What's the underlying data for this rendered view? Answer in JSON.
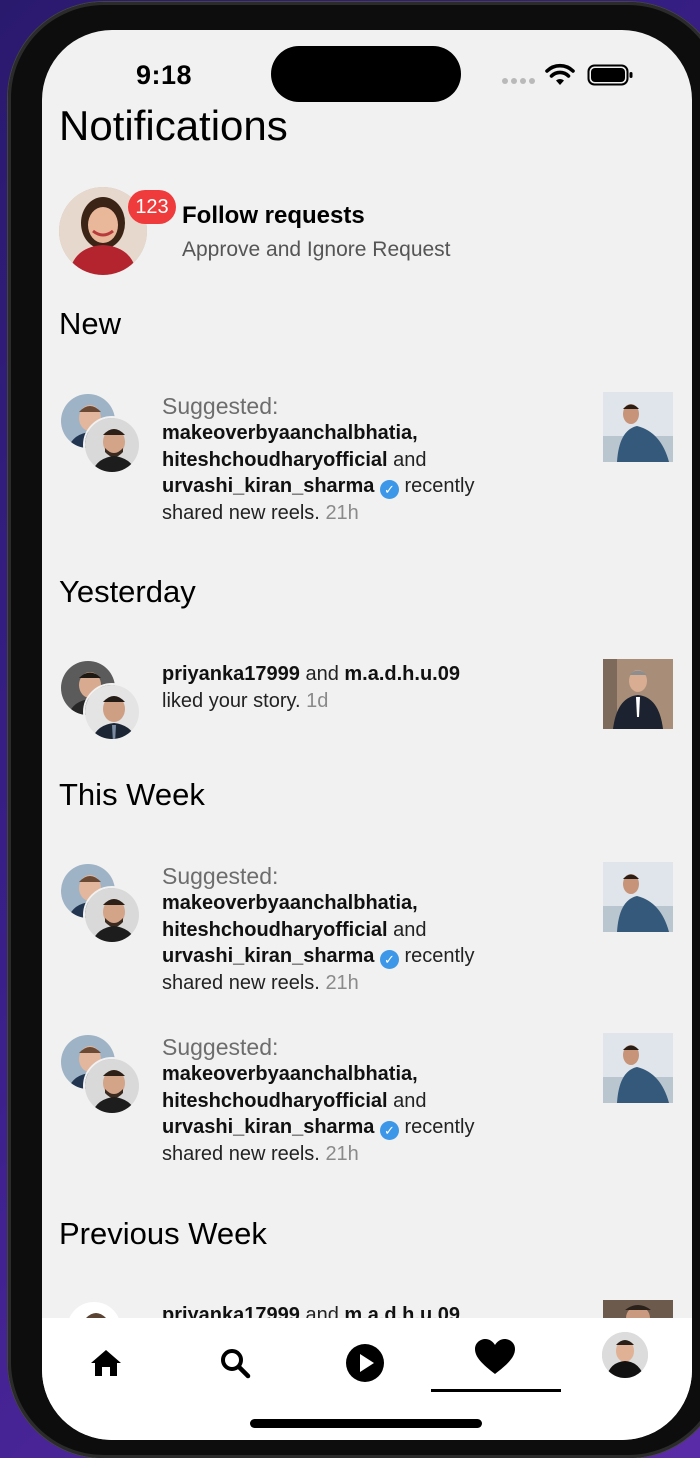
{
  "status_bar": {
    "time": "9:18"
  },
  "page": {
    "title": "Notifications"
  },
  "follow_requests": {
    "badge_count": "123",
    "title": "Follow requests",
    "subtitle": "Approve and Ignore Request"
  },
  "sections": {
    "new": "New",
    "yesterday": "Yesterday",
    "this_week": "This Week",
    "previous_week": "Previous Week"
  },
  "suggested_reel": {
    "label": "Suggested:",
    "user1": "makeoverbyaanchalbhatia,",
    "user2": "hiteshchoudharyofficial",
    "and": "and",
    "user3": "urvashi_kiran_sharma",
    "verified_icon": "verified-check-icon",
    "recently": "recently",
    "action": "shared new reels.",
    "time": "21h"
  },
  "story_like": {
    "user1": "priyanka17999",
    "and": "and",
    "user2": "m.a.d.h.u.09",
    "action": "liked your story.",
    "time": "1d"
  },
  "tab_bar": {
    "items": [
      "home-icon",
      "search-icon",
      "reels-play-icon",
      "heart-icon",
      "profile-avatar"
    ],
    "active": "heart-icon"
  },
  "colors": {
    "badge": "#ef3b3b",
    "verified": "#3c97e8",
    "background": "#f1f1f1"
  }
}
